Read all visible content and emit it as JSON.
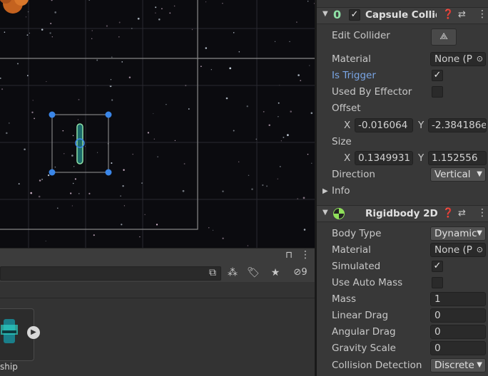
{
  "capsule": {
    "title": "Capsule Collide",
    "edit_collider": "Edit Collider",
    "material_label": "Material",
    "material_value": "None (P",
    "is_trigger_label": "Is Trigger",
    "is_trigger_checked": "✓",
    "used_by_effector_label": "Used By Effector",
    "offset_label": "Offset",
    "offset_x_label": "X",
    "offset_x": "-0.016064",
    "offset_y_label": "Y",
    "offset_y": "-2.384186e",
    "size_label": "Size",
    "size_x_label": "X",
    "size_x": "0.1349931",
    "size_y_label": "Y",
    "size_y": "1.152556",
    "direction_label": "Direction",
    "direction_value": "Vertical",
    "info_label": "Info"
  },
  "rigidbody": {
    "title": "Rigidbody 2D",
    "body_type_label": "Body Type",
    "body_type_value": "Dynamic",
    "material_label": "Material",
    "material_value": "None (P",
    "simulated_label": "Simulated",
    "simulated_checked": "✓",
    "use_auto_mass_label": "Use Auto Mass",
    "mass_label": "Mass",
    "mass_value": "1",
    "linear_drag_label": "Linear Drag",
    "linear_drag_value": "0",
    "angular_drag_label": "Angular Drag",
    "angular_drag_value": "0",
    "gravity_scale_label": "Gravity Scale",
    "gravity_scale_value": "0",
    "collision_detection_label": "Collision Detection",
    "collision_detection_value": "Discrete"
  },
  "project": {
    "hidden_count": "9",
    "asset_label": "ship"
  },
  "colors": {
    "accent_blue": "#3a86e8",
    "collider_green": "#8fe0a6",
    "link_blue": "#7aa6e6"
  }
}
